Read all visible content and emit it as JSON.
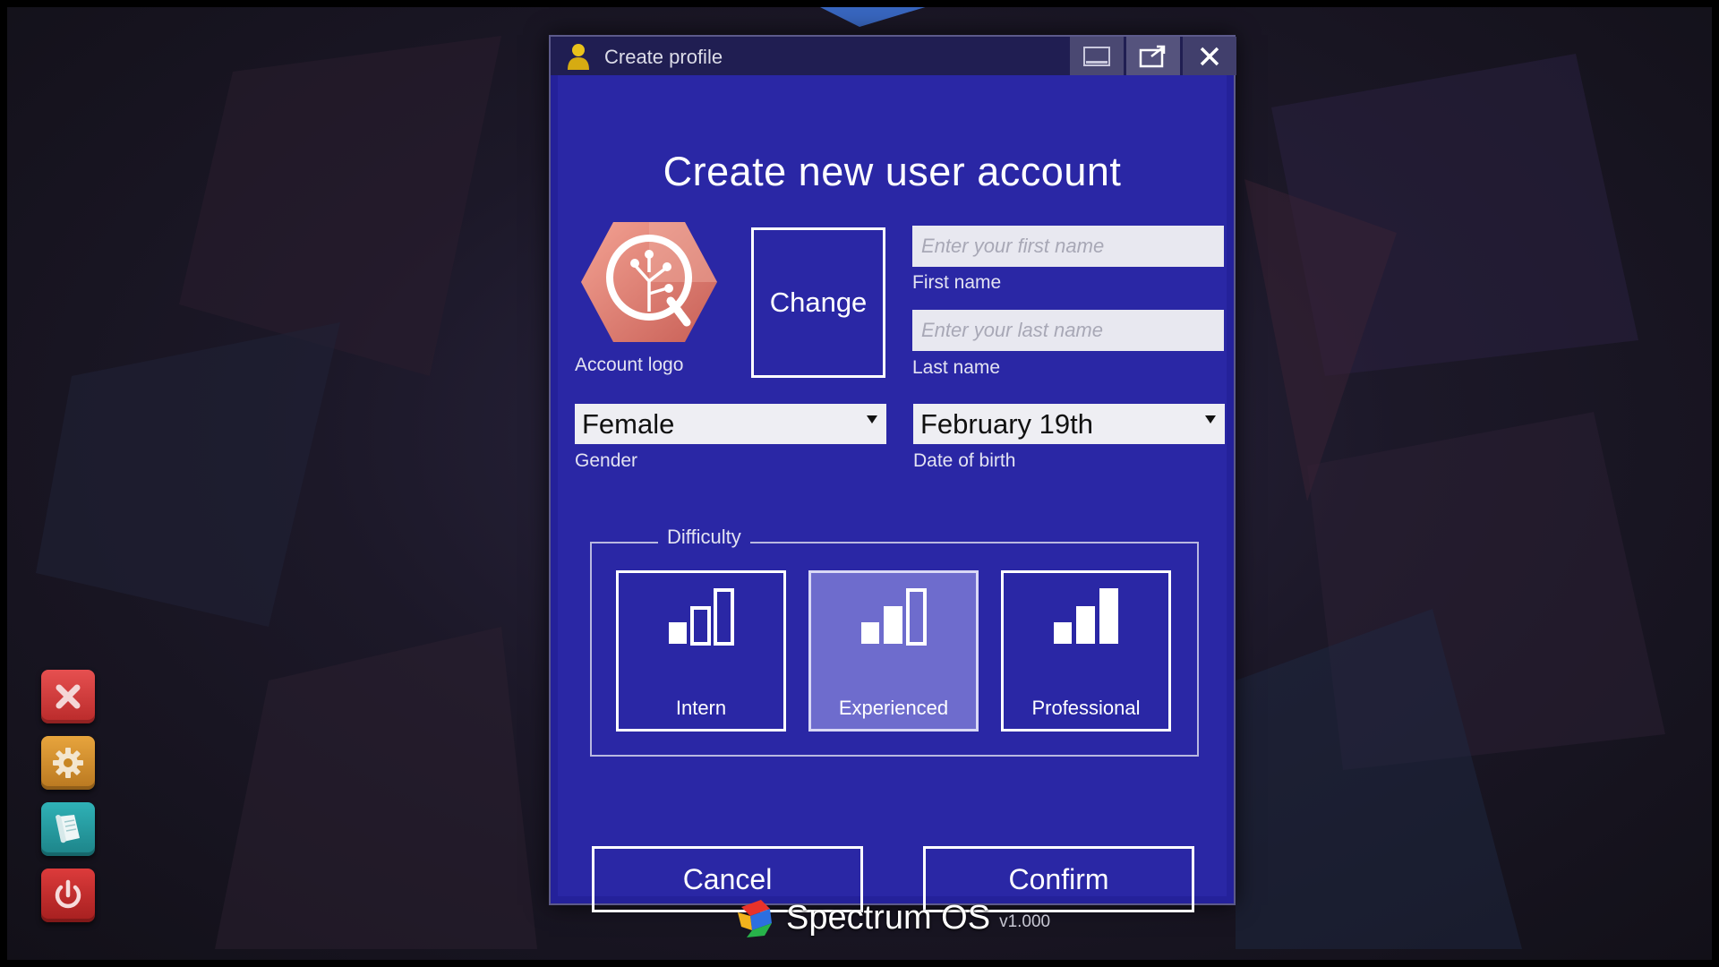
{
  "window": {
    "title": "Create profile"
  },
  "form": {
    "heading": "Create new user account",
    "logo_label": "Account logo",
    "change_label": "Change",
    "first_name": {
      "placeholder": "Enter your first name",
      "label": "First name"
    },
    "last_name": {
      "placeholder": "Enter your last name",
      "label": "Last name"
    },
    "gender": {
      "value": "Female",
      "label": "Gender"
    },
    "dob": {
      "value": "February 19th",
      "label": "Date of birth"
    },
    "difficulty": {
      "legend": "Difficulty",
      "options": [
        {
          "name": "Intern",
          "selected": false,
          "filled_bars": 1
        },
        {
          "name": "Experienced",
          "selected": true,
          "filled_bars": 2
        },
        {
          "name": "Professional",
          "selected": false,
          "filled_bars": 3
        }
      ]
    },
    "cancel_label": "Cancel",
    "confirm_label": "Confirm"
  },
  "dock": {
    "items": [
      {
        "icon": "close-icon",
        "color": "#d33b3b"
      },
      {
        "icon": "gear-icon",
        "color": "#d48e2d"
      },
      {
        "icon": "scroll-icon",
        "color": "#249a9f"
      },
      {
        "icon": "power-icon",
        "color": "#c52c2c"
      }
    ]
  },
  "brand": {
    "name": "Spectrum OS",
    "version": "v1.000"
  },
  "colors": {
    "window_bg": "#2a27a5",
    "titlebar_bg": "#201e52",
    "selected_card": "#6e6ccd",
    "logo_hex": "#e8857a"
  }
}
